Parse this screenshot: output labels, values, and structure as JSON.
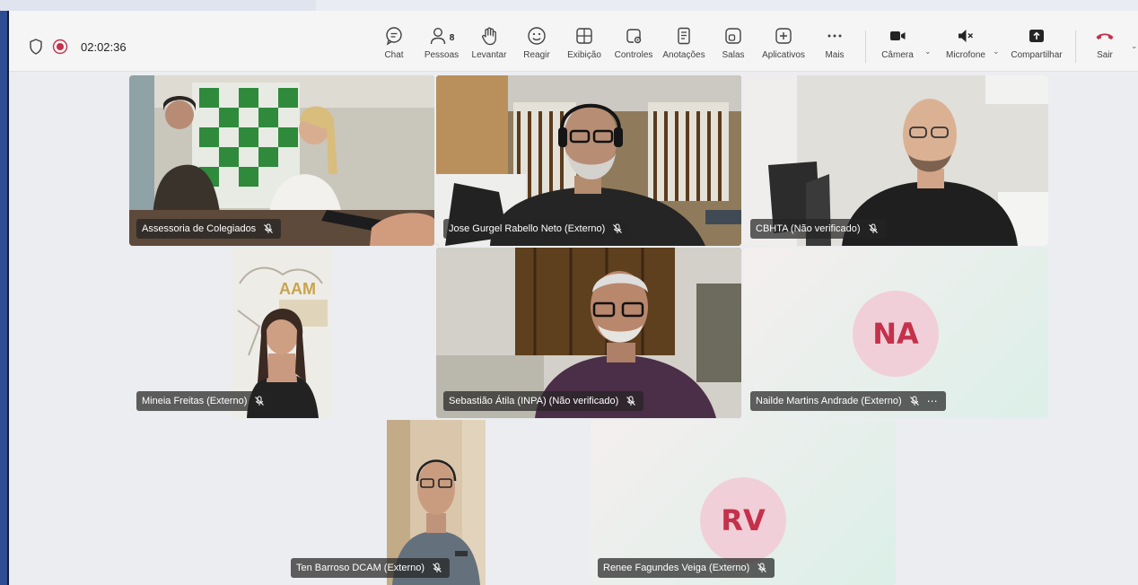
{
  "meeting": {
    "timer": "02:02:36"
  },
  "toolbar": {
    "people_count": "8",
    "buttons": {
      "chat": "Chat",
      "people": "Pessoas",
      "raise": "Levantar",
      "react": "Reagir",
      "view": "Exibição",
      "controls": "Controles",
      "notes": "Anotações",
      "rooms": "Salas",
      "apps": "Aplicativos",
      "more": "Mais",
      "camera": "Câmera",
      "mic": "Microfone",
      "share": "Compartilhar",
      "leave": "Sair"
    },
    "icons": {
      "chat": "chat-icon",
      "people": "people-icon",
      "raise": "raise-hand-icon",
      "react": "react-icon",
      "view": "view-icon",
      "controls": "controls-icon",
      "notes": "notes-icon",
      "rooms": "rooms-icon",
      "apps": "apps-icon",
      "more": "more-icon",
      "camera": "camera-icon",
      "mic": "speaker-muted-icon",
      "share": "share-icon",
      "leave": "hang-up-icon"
    },
    "colors": {
      "leave": "#c4314b",
      "record": "#c4314b"
    }
  },
  "participants": [
    {
      "name": "Assessoria de Colegiados",
      "muted": true
    },
    {
      "name": "Jose Gurgel Rabello Neto (Externo)",
      "muted": true
    },
    {
      "name": "CBHTA (Não verificado)",
      "muted": true
    },
    {
      "name": "Mineia Freitas (Externo)",
      "muted": true
    },
    {
      "name": "Sebastião Átila (INPA) (Não verificado)",
      "muted": true
    },
    {
      "name": "Nailde Martins Andrade (Externo)",
      "muted": true,
      "initials": "NA"
    },
    {
      "name": "Ten Barroso DCAM (Externo)",
      "muted": true
    },
    {
      "name": "Renee Fagundes Veiga (Externo)",
      "muted": true,
      "initials": "RV"
    }
  ],
  "video_logo": {
    "text": "AAM"
  }
}
